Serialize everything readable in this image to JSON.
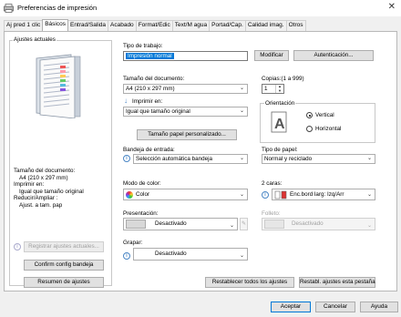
{
  "window": {
    "title": "Preferencias de impresión"
  },
  "tabs": [
    "Aj pred 1 clic",
    "Básicos",
    "Entrad/Salida",
    "Acabado",
    "Format/Edic",
    "Text/M agua",
    "Portad/Cap.",
    "Calidad imag.",
    "Otros"
  ],
  "left": {
    "heading": "Ajustes actuales",
    "summary": [
      "Tamaño del documento:",
      "A4 (210 x 297 mm)",
      "Imprimir en:",
      "Igual que tamaño original",
      "Reducir/Ampliar :",
      "Ajust. a tam. pap"
    ],
    "register_btn": "Registrar ajustes actuales...",
    "confirm_btn": "Confirm config bandeja",
    "summary_btn": "Resumen de ajustes"
  },
  "job_type": {
    "label": "Tipo de trabajo:",
    "value": "Impresión normal",
    "modify_btn": "Modificar",
    "auth_btn": "Autenticación..."
  },
  "doc_size": {
    "label": "Tamaño del documento:",
    "value": "A4 (210 x 297 mm)"
  },
  "print_on": {
    "label": "Imprimir en:",
    "value": "Igual que tamaño original"
  },
  "custom_btn": "Tamaño papel personalizado...",
  "copies": {
    "label": "Copias:(1 a 999)",
    "value": "1"
  },
  "orientation": {
    "label": "Orientación",
    "options": [
      "Vertical",
      "Horizontal"
    ],
    "selected": "Vertical"
  },
  "tray": {
    "label": "Bandeja de entrada:",
    "value": "Selección automática bandeja"
  },
  "paper_type": {
    "label": "Tipo de papel:",
    "value": "Normal y reciclado"
  },
  "color_mode": {
    "label": "Modo de color:",
    "value": "Color"
  },
  "duplex": {
    "label": "2 caras:",
    "value": "Enc.bord larg: Izq/Arr"
  },
  "layout": {
    "label": "Presentación:",
    "value": "Desactivado"
  },
  "booklet": {
    "label": "Folleto:",
    "value": "Desactivado"
  },
  "staple": {
    "label": "Grapar:",
    "value": "Desactivado"
  },
  "reset_all_btn": "Restablecer todos los ajustes",
  "reset_tab_btn": "Restabl. ajustes esta pestaña",
  "footer": {
    "ok": "Aceptar",
    "cancel": "Cancelar",
    "help": "Ayuda"
  },
  "colors": {
    "accent": "#0078d7",
    "info_icon": "#4a86c5"
  }
}
